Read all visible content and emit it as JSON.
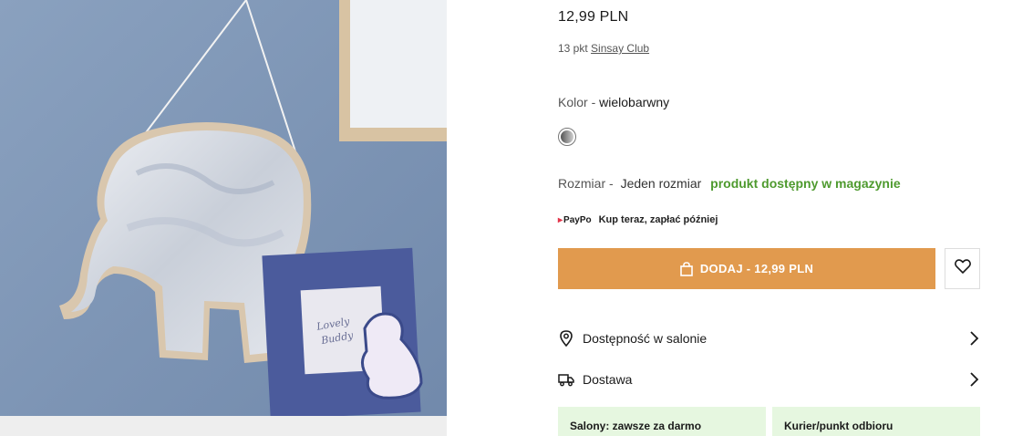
{
  "product": {
    "price": "12,99 PLN",
    "points_prefix": "13 pkt",
    "points_link": "Sinsay Club"
  },
  "color": {
    "label": "Kolor - ",
    "value": "wielobarwny",
    "swatch_icon": "multicolor-swatch"
  },
  "size": {
    "label": "Rozmiar - ",
    "value": "Jeden rozmiar",
    "availability": "produkt dostępny w magazynie",
    "availability_color": "#4e9a2e"
  },
  "paypo": {
    "logo": "PayPo",
    "text": "Kup teraz, zapłać później"
  },
  "actions": {
    "add_label": "DODAJ - 12,99 PLN",
    "add_color": "#e19a4e",
    "wishlist_icon": "heart-icon"
  },
  "info_rows": {
    "store_label": "Dostępność w salonie",
    "delivery_label": "Dostawa"
  },
  "delivery_cards": {
    "salon": "Salony: zawsze za darmo",
    "courier": "Kurier/punkt odbioru"
  }
}
